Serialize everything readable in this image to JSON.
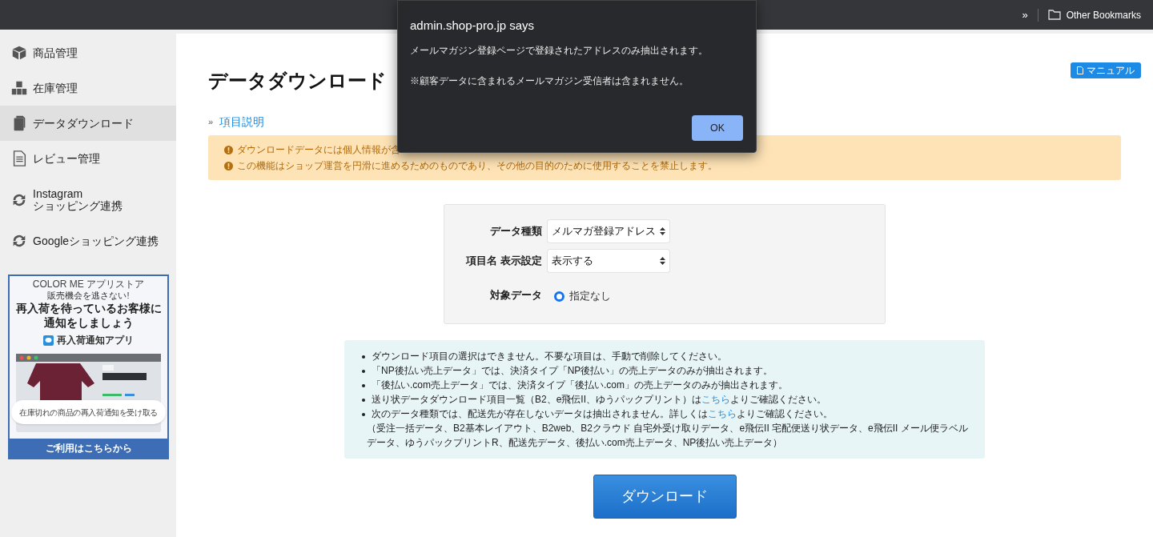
{
  "browser_bar": {
    "overflow": "»",
    "bookmarks_folder": "Other Bookmarks"
  },
  "sidebar": {
    "items": [
      {
        "label": "商品管理",
        "selected": false
      },
      {
        "label": "在庫管理",
        "selected": false
      },
      {
        "label": "データダウンロード",
        "selected": true
      },
      {
        "label": "レビュー管理",
        "selected": false
      },
      {
        "label": "Instagram\nショッピング連携",
        "selected": false
      },
      {
        "label": "Googleショッピング連携",
        "selected": false
      }
    ],
    "banner": {
      "brand": "COLOR ME アプリストア",
      "tagline": "販売機会を逃さない!",
      "headline": [
        "再入荷を待っているお客様に",
        "通知をしましょう"
      ],
      "app_name": "再入荷通知アプリ",
      "pill": "在庫切れの商品の再入荷通知を受け取る",
      "footer": "ご利用はこちらから"
    }
  },
  "page": {
    "title": "データダウンロード",
    "manual_button": "マニュアル",
    "help_link": {
      "marker": "»",
      "label": "項目説明"
    },
    "warnings": [
      "ダウンロードデータには個人情報が含",
      "この機能はショップ運営を円滑に進めるためのものであり、その他の目的のために使用することを禁止します。"
    ],
    "form": {
      "fields": [
        {
          "kind": "select",
          "label": "データ種類",
          "value": "メルマガ登録アドレス"
        },
        {
          "kind": "select",
          "label": "項目名 表示設定",
          "value": "表示する"
        },
        {
          "kind": "radio",
          "label": "対象データ",
          "options": [
            {
              "label": "指定なし",
              "selected": true
            }
          ]
        }
      ]
    },
    "notes": [
      {
        "text": "ダウンロード項目の選択はできません。不要な項目は、手動で削除してください。"
      },
      {
        "text": "「NP後払い売上データ」では、決済タイプ「NP後払い」の売上データのみが抽出されます。"
      },
      {
        "text": "「後払い.com売上データ」では、決済タイプ「後払い.com」の売上データのみが抽出されます。"
      },
      {
        "text": "送り状データダウンロード項目一覧（B2、e飛伝II、ゆうパックプリント）は",
        "link": "こちら",
        "after": "よりご確認ください。"
      },
      {
        "text": "次のデータ種類では、配送先が存在しないデータは抽出されません。詳しくは",
        "link": "こちら",
        "after": "よりご確認ください。",
        "detail": "（受注一括データ、B2基本レイアウト、B2web、B2クラウド 自宅外受け取りデータ、e飛伝II 宅配便送り状データ、e飛伝II メール便ラベルデータ、ゆうパックプリントR、配送先データ、後払い.com売上データ、NP後払い売上データ）"
      }
    ],
    "download_button": "ダウンロード"
  },
  "dialog": {
    "title": "admin.shop-pro.jp says",
    "messages": [
      "メールマガジン登録ページで登録されたアドレスのみ抽出されます。",
      "※顧客データに含まれるメールマガジン受信者は含まれません。"
    ],
    "ok_button": "OK"
  }
}
